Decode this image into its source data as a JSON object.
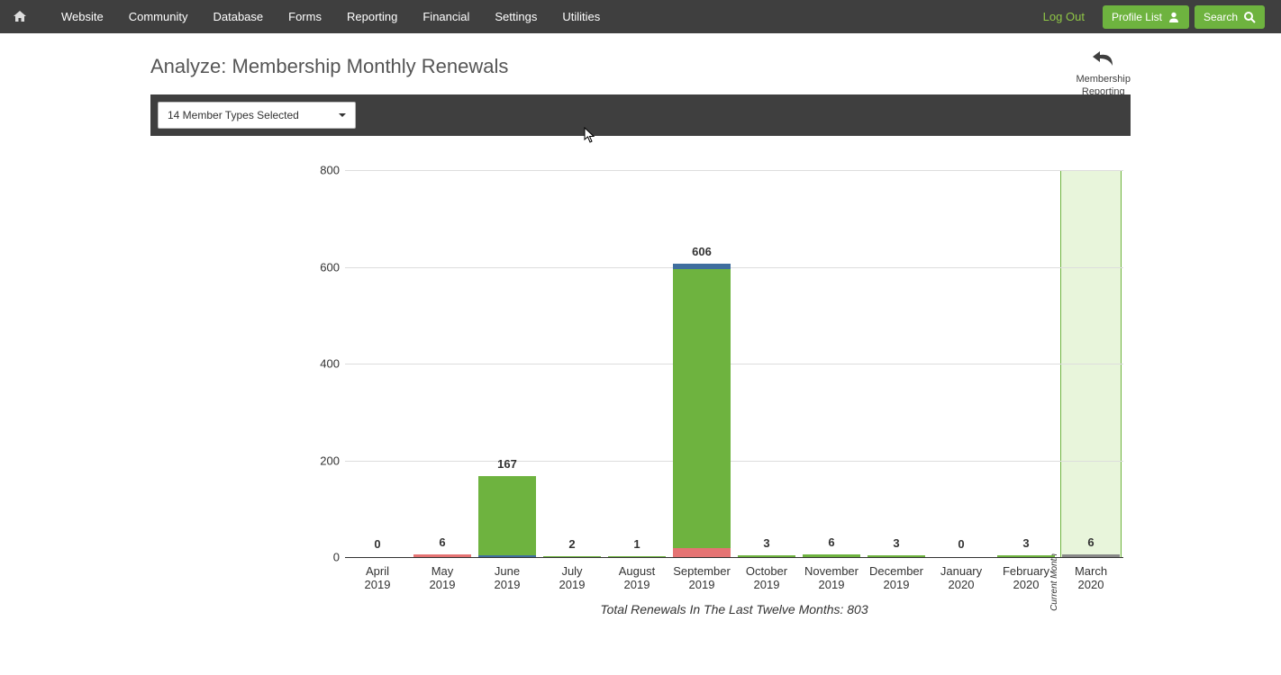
{
  "nav": {
    "items": [
      "Website",
      "Community",
      "Database",
      "Forms",
      "Reporting",
      "Financial",
      "Settings",
      "Utilities"
    ],
    "logout": "Log Out",
    "profile_list": "Profile List",
    "search": "Search"
  },
  "page": {
    "title": "Analyze: Membership Monthly Renewals",
    "back_label_1": "Membership",
    "back_label_2": "Reporting"
  },
  "filter": {
    "select_label": "14 Member Types Selected"
  },
  "chart_data": {
    "type": "bar",
    "categories": [
      [
        "April",
        "2019"
      ],
      [
        "May",
        "2019"
      ],
      [
        "June",
        "2019"
      ],
      [
        "July",
        "2019"
      ],
      [
        "August",
        "2019"
      ],
      [
        "September",
        "2019"
      ],
      [
        "October",
        "2019"
      ],
      [
        "November",
        "2019"
      ],
      [
        "December",
        "2019"
      ],
      [
        "January",
        "2020"
      ],
      [
        "February",
        "2020"
      ],
      [
        "March",
        "2020"
      ]
    ],
    "values": [
      0,
      6,
      167,
      2,
      1,
      606,
      3,
      6,
      3,
      0,
      3,
      6
    ],
    "title": "",
    "xlabel": "",
    "ylabel": "",
    "ylim": [
      0,
      800
    ],
    "yticks": [
      0,
      200,
      400,
      600,
      800
    ],
    "current_month_index": 11,
    "current_month_label": "Current Month",
    "caption": "Total Renewals In The Last Twelve Months: 803",
    "stacks": {
      "5": [
        {
          "color": "red",
          "from": 0,
          "to": 18
        },
        {
          "color": "green",
          "from": 18,
          "to": 596
        },
        {
          "color": "blue",
          "from": 596,
          "to": 606
        }
      ],
      "2": [
        {
          "color": "blue",
          "from": 0,
          "to": 4
        },
        {
          "color": "green",
          "from": 4,
          "to": 167
        }
      ],
      "1": [
        {
          "color": "red",
          "from": 0,
          "to": 6
        }
      ],
      "11": [
        {
          "color": "grey",
          "from": 0,
          "to": 6
        }
      ]
    }
  }
}
